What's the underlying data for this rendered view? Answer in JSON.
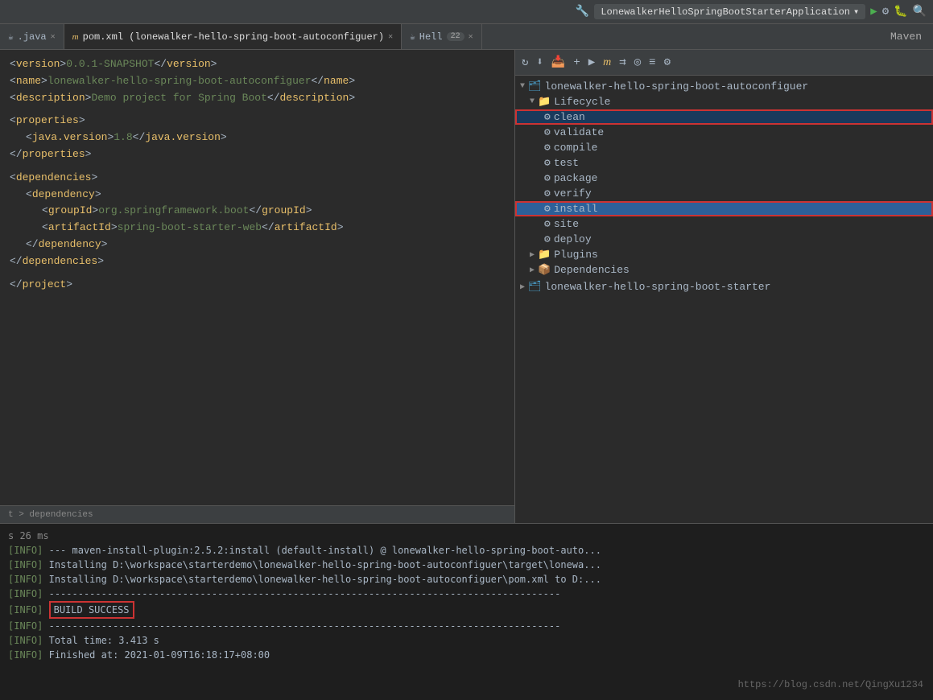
{
  "titleBar": {
    "appName": "LonewalkerHelloSpringBootStarterApplication",
    "icons": [
      "wrench",
      "play",
      "settings",
      "debug",
      "search"
    ]
  },
  "tabs": [
    {
      "id": "java",
      "label": ".java",
      "icon": "☕",
      "active": false,
      "closable": true
    },
    {
      "id": "pom",
      "label": "pom.xml (lonewalker-hello-spring-boot-autoconfiguer)",
      "icon": "m",
      "active": true,
      "closable": true
    },
    {
      "id": "hell",
      "label": "Hell",
      "icon": "☕",
      "active": false,
      "closable": true,
      "badge": "22"
    }
  ],
  "mavenTabLabel": "Maven",
  "editor": {
    "lines": [
      {
        "indent": 0,
        "content": "<version>0.0.1-SNAPSHOT</version>"
      },
      {
        "indent": 0,
        "content": "<name>lonewalker-hello-spring-boot-autoconfiguer</name>"
      },
      {
        "indent": 0,
        "content": "<description>Demo project for Spring Boot</description>"
      },
      {
        "indent": 0,
        "content": ""
      },
      {
        "indent": 0,
        "content": "<properties>"
      },
      {
        "indent": 1,
        "content": "<java.version>1.8</java.version>"
      },
      {
        "indent": 0,
        "content": "</properties>"
      },
      {
        "indent": 0,
        "content": ""
      },
      {
        "indent": 0,
        "content": "<dependencies>"
      },
      {
        "indent": 1,
        "content": "<dependency>"
      },
      {
        "indent": 2,
        "content": "<groupId>org.springframework.boot</groupId>"
      },
      {
        "indent": 2,
        "content": "<artifactId>spring-boot-starter-web</artifactId>"
      },
      {
        "indent": 1,
        "content": "</dependency>"
      },
      {
        "indent": 0,
        "content": "</dependencies>"
      },
      {
        "indent": 0,
        "content": ""
      },
      {
        "indent": 0,
        "content": "</project>"
      }
    ]
  },
  "statusBar": {
    "breadcrumb": "t > dependencies"
  },
  "mavenPanel": {
    "rootProject": "lonewalker-hello-spring-boot-autoconfiguer",
    "lifecycle": {
      "label": "Lifecycle",
      "items": [
        "clean",
        "validate",
        "compile",
        "test",
        "package",
        "verify",
        "install",
        "site",
        "deploy"
      ]
    },
    "plugins": {
      "label": "Plugins"
    },
    "dependencies": {
      "label": "Dependencies"
    },
    "subProject": "lonewalker-hello-spring-boot-starter"
  },
  "console": {
    "lines": [
      {
        "prefix": "[INFO]",
        "text": " --- maven-install-plugin:2.5.2:install (default-install) @ lonewalker-hello-spring-boot-auto..."
      },
      {
        "prefix": "[INFO]",
        "text": " Installing D:\\workspace\\starterdemo\\lonewalker-hello-spring-boot-autoconfiguer\\target\\lonewa..."
      },
      {
        "prefix": "[INFO]",
        "text": " Installing D:\\workspace\\starterdemo\\lonewalker-hello-spring-boot-autoconfiguer\\pom.xml to D:..."
      },
      {
        "prefix": "[INFO]",
        "text": " ----------------------------------------------------------------------------------------"
      },
      {
        "prefix": "[INFO]",
        "text": " BUILD SUCCESS",
        "highlight": true
      },
      {
        "prefix": "[INFO]",
        "text": " ----------------------------------------------------------------------------------------"
      },
      {
        "prefix": "[INFO]",
        "text": " Total time:  3.413 s"
      },
      {
        "prefix": "[INFO]",
        "text": " Finished at: 2021-01-09T16:18:17+08:00"
      }
    ],
    "timeLabel": "s 26 ms",
    "watermark": "https://blog.csdn.net/QingXu1234"
  }
}
